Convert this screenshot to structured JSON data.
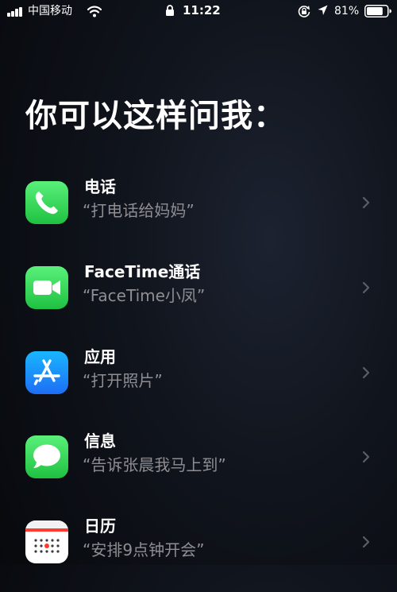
{
  "status_bar": {
    "carrier": "中国移动",
    "time": "11:22",
    "battery": "81%",
    "battery_level": 0.81
  },
  "heading": "你可以这样问我：",
  "suggestions": [
    {
      "app": "电话",
      "example": "“打电话给妈妈”",
      "icon": "phone-icon",
      "color": "#34c759"
    },
    {
      "app": "FaceTime通话",
      "example": "“FaceTime小凤”",
      "icon": "video-camera-icon",
      "color": "#34c759"
    },
    {
      "app": "应用",
      "example": "“打开照片”",
      "icon": "app-store-icon",
      "color": "#1a8cff"
    },
    {
      "app": "信息",
      "example": "“告诉张晨我马上到”",
      "icon": "message-bubble-icon",
      "color": "#34c759"
    },
    {
      "app": "日历",
      "example": "“安排9点钟开会”",
      "icon": "calendar-icon",
      "color": "#ffffff"
    }
  ]
}
